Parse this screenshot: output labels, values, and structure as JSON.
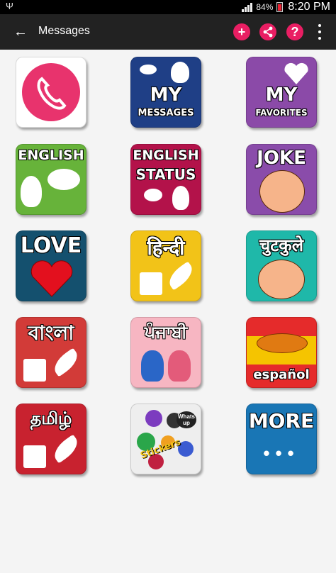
{
  "status_bar": {
    "usb_icon": "usb-icon",
    "battery_percent": "84%",
    "time": "8:20 PM"
  },
  "action_bar": {
    "title": "Messages",
    "add_symbol": "+",
    "help_symbol": "?"
  },
  "tiles": {
    "my_messages": {
      "line1": "MY",
      "line2": "MESSAGES"
    },
    "my_favorites": {
      "line1": "MY",
      "line2": "FAVORITES"
    },
    "english": {
      "label": "ENGLISH"
    },
    "english_status": {
      "line1": "ENGLISH",
      "line2": "STATUS"
    },
    "joke": {
      "label": "JOKE"
    },
    "love": {
      "label": "LOVE"
    },
    "hindi": {
      "label": "हिन्दी"
    },
    "chutkule": {
      "label": "चुटकुले"
    },
    "bangla": {
      "label": "বাংলা"
    },
    "punjabi": {
      "label": "ਪੰਜਾਬੀ"
    },
    "espanol": {
      "label": "español"
    },
    "tamil": {
      "label": "தமிழ்"
    },
    "stickers": {
      "label": "Stickers",
      "badge": "Whats up"
    },
    "more": {
      "label": "MORE",
      "dots": "•••"
    }
  },
  "colors": {
    "accent": "#e91e63",
    "call": "#e8336d",
    "my_messages": "#1f3f86",
    "my_favorites": "#8b4aa8",
    "english": "#67b33a",
    "english_status": "#b3124a",
    "joke": "#8a4caa",
    "love": "#14506e",
    "hindi": "#f2c318",
    "chutkule": "#1fb8a9",
    "bangla": "#d23b38",
    "punjabi": "#f7b6c2",
    "espanol": "#e52b2b",
    "tamil": "#c8222f",
    "more": "#1976b5"
  }
}
